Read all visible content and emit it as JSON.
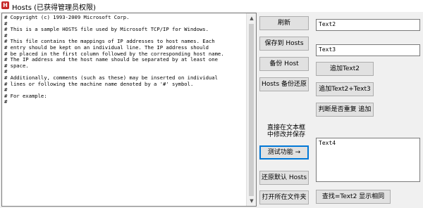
{
  "window": {
    "app_icon": "H",
    "title": "Hosts (已获得管理员权限)"
  },
  "editor": {
    "content": "# Copyright (c) 1993-2009 Microsoft Corp.\n#\n# This is a sample HOSTS file used by Microsoft TCP/IP for Windows.\n#\n# This file contains the mappings of IP addresses to host names. Each\n# entry should be kept on an individual line. The IP address should\n# be placed in the first column followed by the corresponding host name.\n# The IP address and the host name should be separated by at least one\n# space.\n#\n# Additionally, comments (such as these) may be inserted on individual\n# lines or following the machine name denoted by a '#' symbol.\n#\n# For example:\n#"
  },
  "buttons": {
    "refresh": "刷新",
    "save_hosts": "保存到 Hosts",
    "backup_host": "备份 Host",
    "restore_backup": "Hosts 备份还原",
    "test_function": "测试功能 →",
    "restore_default": "还原默认 Hosts",
    "open_folder": "打开所在文件夹",
    "add_text2": "追加Text2",
    "add_text2_text3": "追加Text2+Text3",
    "check_duplicate": "判断是否重复 追加",
    "find_text2": "查找=Text2 显示相同"
  },
  "note": {
    "line1": "直接在文本框",
    "line2": "中修改并保存"
  },
  "inputs": {
    "text2": "Text2",
    "text3": "Text3",
    "text4": "Text4"
  }
}
